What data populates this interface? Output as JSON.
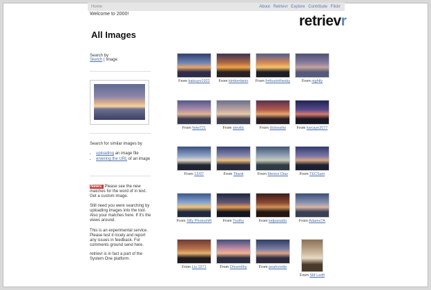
{
  "topbar": {
    "home": "Home",
    "links": [
      "About",
      "Retrievr",
      "Explore",
      "Contribute",
      "Flickr"
    ]
  },
  "welcome": "Welcome to 2000!",
  "logo": {
    "main": "retriev",
    "accent": "r"
  },
  "title": "All Images",
  "sidebar": {
    "search_by_label": "Search by",
    "search_by_link": "Sketch",
    "search_by_sep": " | ",
    "search_by_current": "Image",
    "similar_heading": "Search for similar images by",
    "option1_link": "uploading",
    "option1_rest": " an image file",
    "option2_link": "entering the URL",
    "option2_rest": " of an image",
    "news_badge": "News:",
    "news_text": "Please see the new matches for the word of in text. Get a custom image.",
    "para2": "Still need you were searching by uploading images into the tool. Also your matches here. If it's the views around.",
    "para3": "This is an experimental service. Please test it nicely and report any issues in feedback. For comments ground send here.",
    "para4": "retrievr is in fact a part of the System One platform."
  },
  "tiles": [
    {
      "prefix": "From ",
      "user": "katsuyo1922",
      "palette": [
        "#2c3f6e",
        "#7486b4",
        "#e9a86a",
        "#2d2c4a"
      ]
    },
    {
      "prefix": "From ",
      "user": "kimbertanio",
      "palette": [
        "#3a3154",
        "#b36b44",
        "#f0a548",
        "#2a2122"
      ]
    },
    {
      "prefix": "From ",
      "user": "fmfourinthesky",
      "palette": [
        "#4f5d8c",
        "#d98b57",
        "#f5c46a",
        "#1e1e26"
      ]
    },
    {
      "prefix": "From ",
      "user": "nightly",
      "palette": [
        "#4d4f74",
        "#8a7fa0",
        "#c5a49b",
        "#555a7c"
      ]
    },
    {
      "prefix": "From ",
      "user": "fwiw721",
      "palette": [
        "#50598c",
        "#b18ea9",
        "#e2b58e",
        "#3a3a52"
      ]
    },
    {
      "prefix": "From ",
      "user": "stevilic",
      "palette": [
        "#6a6f8d",
        "#c0a5a0",
        "#e8c9a7",
        "#3f3f4e"
      ]
    },
    {
      "prefix": "From ",
      "user": "dickwaltw",
      "palette": [
        "#56314f",
        "#b45c4d",
        "#e8a66f",
        "#2a1d25"
      ]
    },
    {
      "prefix": "From ",
      "user": "kwcaye2077",
      "palette": [
        "#1f2450",
        "#5a4a8c",
        "#d67a6c",
        "#1a1725"
      ]
    },
    {
      "prefix": "From ",
      "user": "12/07",
      "palette": [
        "#3b4f7e",
        "#8fa5c9",
        "#e4d8c7",
        "#1f2432"
      ]
    },
    {
      "prefix": "From ",
      "user": "Titanit",
      "palette": [
        "#34406f",
        "#8a8cb2",
        "#f0c07c",
        "#2a2a3d"
      ]
    },
    {
      "prefix": "From ",
      "user": "Mentor Diaz",
      "palette": [
        "#405472",
        "#98a6b9",
        "#c9cbb7",
        "#2e3a45"
      ]
    },
    {
      "prefix": "From ",
      "user": "TECSam",
      "palette": [
        "#313a6b",
        "#7c76a8",
        "#d9a781",
        "#1d2033"
      ]
    },
    {
      "prefix": "From ",
      "user": "Silly Photoshift",
      "palette": [
        "#3a578e",
        "#8ea8d0",
        "#f3c47a",
        "#1f2a40"
      ]
    },
    {
      "prefix": "From ",
      "user": "Toothy",
      "palette": [
        "#1e2640",
        "#645a74",
        "#e89a52",
        "#15161f"
      ]
    },
    {
      "prefix": "From ",
      "user": "kidpaxiatto",
      "palette": [
        "#3a1e1c",
        "#8d4a32",
        "#d0935a",
        "#231512"
      ]
    },
    {
      "prefix": "From ",
      "user": "Adams7A",
      "palette": [
        "#3b4d78",
        "#8b95b2",
        "#d9b5a3",
        "#3a3f55"
      ]
    },
    {
      "prefix": "From ",
      "user": "Liu 1971",
      "palette": [
        "#6c3a33",
        "#b8734c",
        "#e6b26e",
        "#1f1a1e"
      ]
    },
    {
      "prefix": "From ",
      "user": "Otesmithy",
      "palette": [
        "#3f4c7a",
        "#c88fa5",
        "#f2b38c",
        "#2b2d42"
      ]
    },
    {
      "prefix": "From ",
      "user": "peahorette",
      "palette": [
        "#2e3b63",
        "#7b7da0",
        "#d9a38a",
        "#2c2b3e"
      ]
    },
    {
      "prefix": "From ",
      "user": "SM Ledfi",
      "palette": [
        "#8a6f56",
        "#c9b49a",
        "#e8dcc4",
        "#4a3a2c"
      ]
    }
  ]
}
